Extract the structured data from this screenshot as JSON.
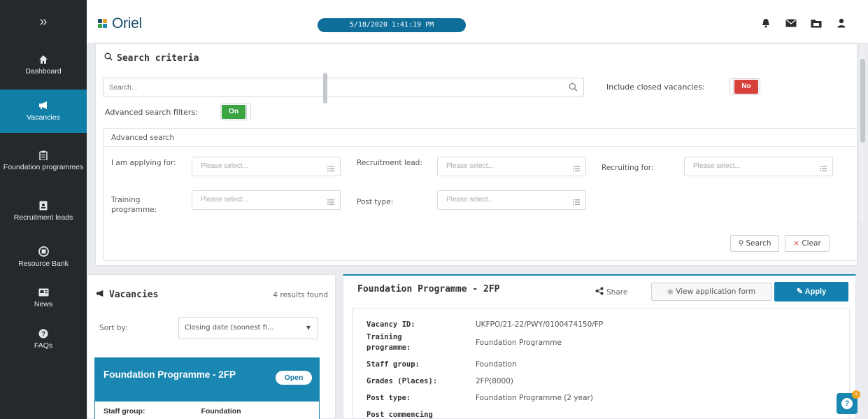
{
  "sidebar": {
    "toggle_glyph": "»",
    "items": [
      {
        "label": "Dashboard",
        "icon": "home-icon"
      },
      {
        "label": "Vacancies",
        "icon": "megaphone-icon",
        "active": true
      },
      {
        "label": "Foundation programmes",
        "icon": "clipboard-icon"
      },
      {
        "label": "Recruitment leads",
        "icon": "id-card-icon"
      },
      {
        "label": "Resource Bank",
        "icon": "archive-icon"
      },
      {
        "label": "News",
        "icon": "newspaper-icon"
      },
      {
        "label": "FAQs",
        "icon": "question-icon"
      }
    ]
  },
  "header": {
    "logo_text": "Oriel",
    "datetime": "5/18/2020 1:41:19 PM",
    "icons": [
      "bell-icon",
      "mail-icon",
      "folder-icon",
      "user-icon"
    ]
  },
  "search": {
    "title": "Search criteria",
    "placeholder": "Search...",
    "include_closed_label": "Include closed vacancies:",
    "include_closed_value": "No",
    "advanced_filters_label": "Advanced search filters:",
    "advanced_filters_value": "On",
    "advanced_title": "Advanced search",
    "filters": [
      {
        "label": "I am applying for:",
        "placeholder": "Please select..."
      },
      {
        "label": "Recruitment lead:",
        "placeholder": "Please select..."
      },
      {
        "label": "Recruiting for:",
        "placeholder": "Please select..."
      },
      {
        "label": "Training programme:",
        "placeholder": "Please select..."
      },
      {
        "label": "Post type:",
        "placeholder": "Please select..."
      }
    ],
    "search_button": "Search",
    "clear_button": "Clear"
  },
  "vacancies": {
    "title": "Vacancies",
    "count_text": "4 results found",
    "sort_label": "Sort by:",
    "sort_value": "Closing date (soonest fi...",
    "card": {
      "title": "Foundation Programme - 2FP",
      "status": "Open",
      "row_label": "Staff group:",
      "row_value": "Foundation"
    }
  },
  "detail": {
    "title": "Foundation Programme - 2FP",
    "share_label": "Share",
    "view_form_label": "View application form",
    "apply_label": "Apply",
    "rows": [
      {
        "key": "Vacancy ID:",
        "value": "UKFPO/21-22/PWY/0100474150/FP"
      },
      {
        "key": "Training programme:",
        "value": "Foundation Programme"
      },
      {
        "key": "Staff group:",
        "value": "Foundation"
      },
      {
        "key": "Grades (Places):",
        "value": "2FP(8000)"
      },
      {
        "key": "Post type:",
        "value": "Foundation Programme (2 year)"
      },
      {
        "key": "Post commencing",
        "value": ""
      }
    ]
  },
  "help": {
    "glyph": "?",
    "badge": "1"
  },
  "colors": {
    "sidebar_bg": "#26292c",
    "accent": "#1a86b2",
    "on_green": "#3aa441",
    "no_red": "#d9423a"
  }
}
